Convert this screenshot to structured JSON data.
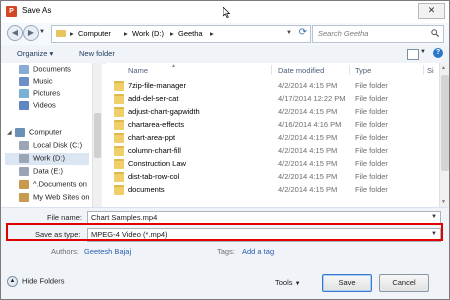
{
  "window": {
    "title": "Save As",
    "app_icon_letter": "P"
  },
  "address": {
    "crumbs": [
      "Computer",
      "Work (D:)",
      "Geetha"
    ],
    "search_placeholder": "Search Geetha"
  },
  "toolbar": {
    "organize": "Organize ▾",
    "new_folder": "New folder"
  },
  "nav": {
    "items": [
      {
        "label": "Documents",
        "icon_color": "#8aa9d4"
      },
      {
        "label": "Music",
        "icon_color": "#6d8fc7"
      },
      {
        "label": "Pictures",
        "icon_color": "#7ab0d8"
      },
      {
        "label": "Videos",
        "icon_color": "#5f86c2"
      },
      {
        "label": "Computer",
        "icon_color": "#6b8fb5"
      },
      {
        "label": "Local Disk (C:)",
        "icon_color": "#9aa6b5"
      },
      {
        "label": "Work (D:)",
        "icon_color": "#9aa6b5"
      },
      {
        "label": "Data (E:)",
        "icon_color": "#9aa6b5"
      },
      {
        "label": "^.Documents on",
        "icon_color": "#c79a4f"
      },
      {
        "label": "My Web Sites on",
        "icon_color": "#c79a4f"
      }
    ]
  },
  "list": {
    "columns": {
      "name": "Name",
      "date": "Date modified",
      "type": "Type",
      "size": "Si"
    },
    "rows": [
      {
        "name": "7zip-file-manager",
        "date": "4/2/2014 4:15 PM",
        "type": "File folder"
      },
      {
        "name": "add-del-ser-cat",
        "date": "4/17/2014 12:22 PM",
        "type": "File folder"
      },
      {
        "name": "adjust-chart-gapwidth",
        "date": "4/2/2014 4:15 PM",
        "type": "File folder"
      },
      {
        "name": "chartarea-effects",
        "date": "4/16/2014 4:16 PM",
        "type": "File folder"
      },
      {
        "name": "chart-area-ppt",
        "date": "4/2/2014 4:15 PM",
        "type": "File folder"
      },
      {
        "name": "column-chart-fill",
        "date": "4/2/2014 4:15 PM",
        "type": "File folder"
      },
      {
        "name": "Construction Law",
        "date": "4/2/2014 4:15 PM",
        "type": "File folder"
      },
      {
        "name": "dist-tab-row-col",
        "date": "4/2/2014 4:15 PM",
        "type": "File folder"
      },
      {
        "name": "documents",
        "date": "4/2/2014 4:15 PM",
        "type": "File folder"
      }
    ]
  },
  "fields": {
    "file_name_label": "File name:",
    "file_name_value": "Chart Samples.mp4",
    "save_type_label": "Save as type:",
    "save_type_value": "MPEG-4 Video (*.mp4)",
    "authors_label": "Authors:",
    "authors_value": "Geetesh Bajaj",
    "tags_label": "Tags:",
    "tags_value": "Add a tag"
  },
  "footer": {
    "hide_folders": "Hide Folders",
    "tools": "Tools",
    "save": "Save",
    "cancel": "Cancel"
  },
  "colors": {
    "highlight": "#e00000",
    "link": "#2a5db0"
  }
}
